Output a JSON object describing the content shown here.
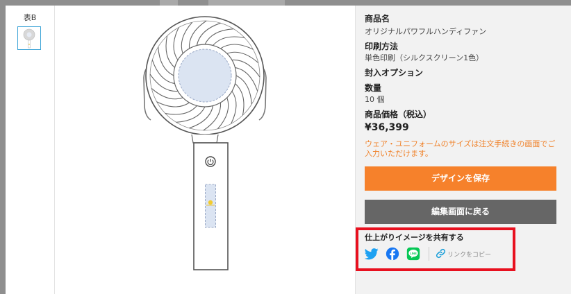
{
  "thumbnails": {
    "side_label": "表B"
  },
  "product": {
    "name_label": "商品名",
    "name_value": "オリジナルパワフルハンディファン",
    "print_label": "印刷方法",
    "print_value": "単色印刷（シルクスクリーン1色）",
    "option_label": "封入オプション",
    "qty_label": "数量",
    "qty_value": "10 個",
    "price_label": "商品価格（税込）",
    "price_value": "¥36,399"
  },
  "notice": "ウェア・ユニフォームのサイズは注文手続きの画面でご入力いただけます。",
  "actions": {
    "save_label": "デザインを保存",
    "back_label": "編集画面に戻る"
  },
  "share": {
    "title": "仕上がりイメージを共有する",
    "copy_label": "リンクをコピー",
    "icons": [
      "twitter-icon",
      "facebook-icon",
      "line-icon",
      "link-icon"
    ]
  },
  "colors": {
    "accent_orange": "#f6812b",
    "dark_button": "#666666",
    "notice_text": "#f0822a",
    "highlight_red": "#e8101f",
    "twitter": "#1da1f2",
    "facebook": "#1877f2",
    "line": "#06c755",
    "print_area": "#dbe4f2"
  }
}
